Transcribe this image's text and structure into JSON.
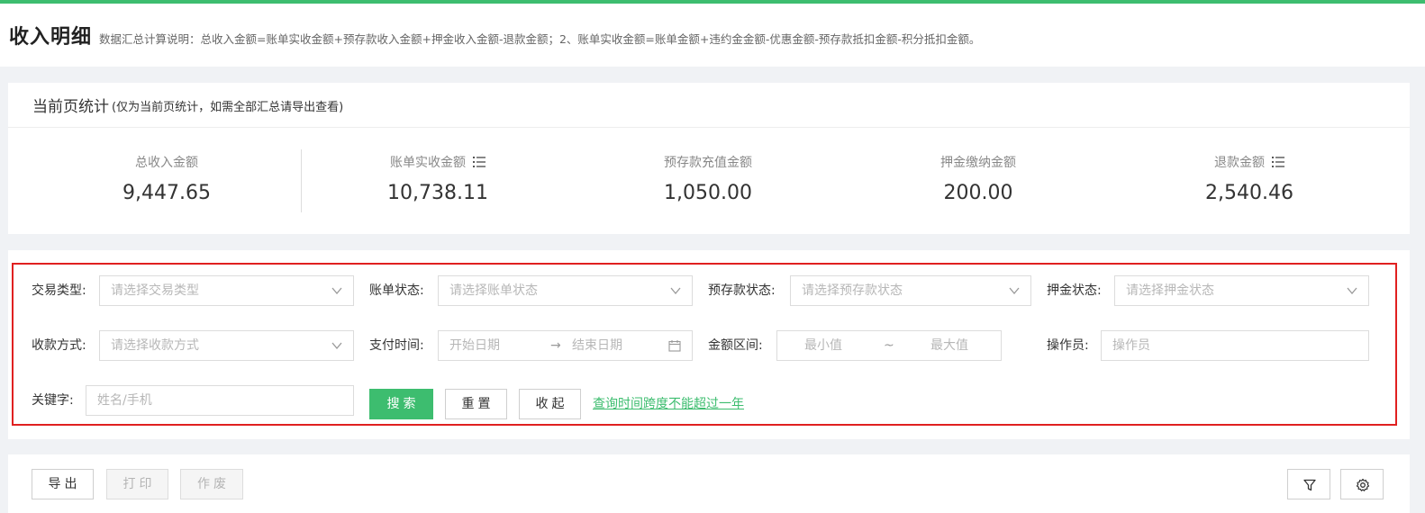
{
  "header": {
    "title": "收入明细",
    "description": "数据汇总计算说明：总收入金额=账单实收金额+预存款收入金额+押金收入金额-退款金额；2、账单实收金额=账单金额+违约金金额-优惠金额-预存款抵扣金额-积分抵扣金额。"
  },
  "stats": {
    "title": "当前页统计",
    "note": "(仅为当前页统计，如需全部汇总请导出查看)",
    "items": [
      {
        "label": "总收入金额",
        "value": "9,447.65"
      },
      {
        "label": "账单实收金额",
        "value": "10,738.11"
      },
      {
        "label": "预存款充值金额",
        "value": "1,050.00"
      },
      {
        "label": "押金缴纳金额",
        "value": "200.00"
      },
      {
        "label": "退款金额",
        "value": "2,540.46"
      }
    ]
  },
  "filters": {
    "transaction_type": {
      "label": "交易类型:",
      "placeholder": "请选择交易类型"
    },
    "bill_status": {
      "label": "账单状态:",
      "placeholder": "请选择账单状态"
    },
    "prepay_status": {
      "label": "预存款状态:",
      "placeholder": "请选择预存款状态"
    },
    "deposit_status": {
      "label": "押金状态:",
      "placeholder": "请选择押金状态"
    },
    "payment_method": {
      "label": "收款方式:",
      "placeholder": "请选择收款方式"
    },
    "pay_time": {
      "label": "支付时间:",
      "start": "开始日期",
      "separator": "→",
      "end": "结束日期"
    },
    "amount_range": {
      "label": "金额区间:",
      "min": "最小值",
      "separator": "~",
      "max": "最大值"
    },
    "operator": {
      "label": "操作员:",
      "placeholder": "操作员"
    },
    "keyword": {
      "label": "关键字:",
      "placeholder": "姓名/手机"
    },
    "search_label": "搜索",
    "reset_label": "重置",
    "collapse_label": "收起",
    "hint": "查询时间跨度不能超过一年"
  },
  "toolbar": {
    "export_label": "导出",
    "print_label": "打印",
    "void_label": "作废"
  },
  "colors": {
    "accent": "#3dbd6f",
    "highlight_border": "#e02020"
  }
}
